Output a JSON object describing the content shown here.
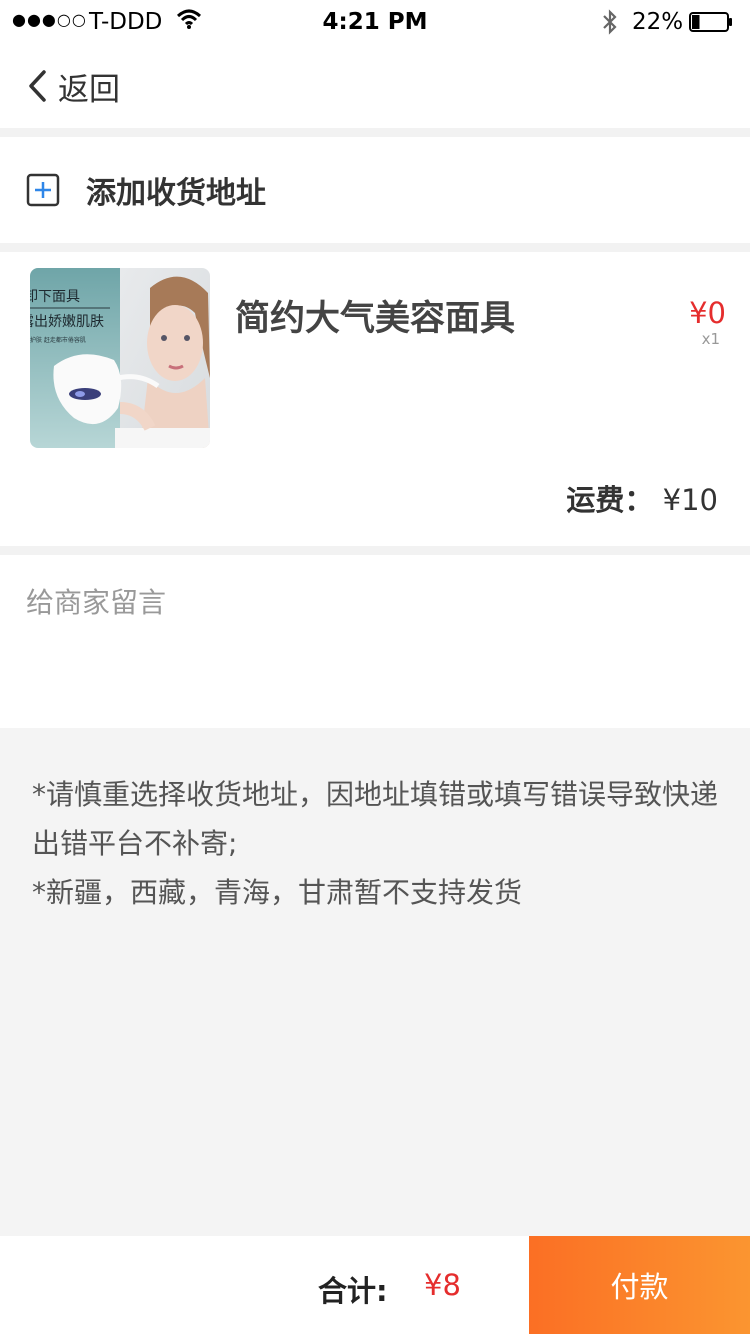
{
  "status_bar": {
    "signal": "●●●○○",
    "carrier": "T-DDD",
    "time": "4:21 PM",
    "battery": "22%",
    "battery_level": 0.22
  },
  "nav": {
    "back_label": "返回"
  },
  "address": {
    "add_label": "添加收货地址"
  },
  "product": {
    "name": "简约大气美容面具",
    "price": "¥0",
    "quantity": "x1",
    "shipping_label": "运费：",
    "shipping_value": "¥10",
    "image_text": {
      "line1": "卸下面具",
      "line2": "露出娇嫩肌肤",
      "line3": "护肤 赶走都市倦容肌"
    }
  },
  "message": {
    "placeholder": "给商家留言"
  },
  "notice": {
    "line1": "*请慎重选择收货地址，因地址填错或填写错误导致快递出错平台不补寄;",
    "line2": "*新疆，西藏，青海，甘肃暂不支持发货"
  },
  "footer": {
    "total_label": "合计:",
    "total_value": "¥8",
    "pay_label": "付款"
  },
  "colors": {
    "price_red": "#e52d2d",
    "pay_gradient_start": "#fb6f24",
    "pay_gradient_end": "#fb9530",
    "add_icon_blue": "#2f86e8",
    "notice_bg": "#f4f4f4"
  }
}
